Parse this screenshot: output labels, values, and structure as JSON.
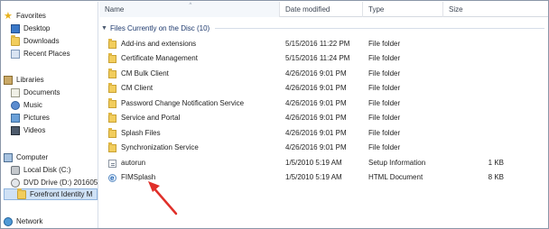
{
  "nav": {
    "favorites": {
      "label": "Favorites",
      "items": [
        {
          "label": "Desktop",
          "icon": "desktop-icon"
        },
        {
          "label": "Downloads",
          "icon": "downloads-icon"
        },
        {
          "label": "Recent Places",
          "icon": "recent-places-icon"
        }
      ]
    },
    "libraries": {
      "label": "Libraries",
      "items": [
        {
          "label": "Documents",
          "icon": "documents-icon"
        },
        {
          "label": "Music",
          "icon": "music-icon"
        },
        {
          "label": "Pictures",
          "icon": "pictures-icon"
        },
        {
          "label": "Videos",
          "icon": "videos-icon"
        }
      ]
    },
    "computer": {
      "label": "Computer",
      "items": [
        {
          "label": "Local Disk (C:)",
          "icon": "local-disk-icon"
        },
        {
          "label": "DVD Drive (D:) 201605",
          "icon": "dvd-drive-icon"
        },
        {
          "label": "Forefront Identity M",
          "icon": "folder-icon",
          "selected": true
        }
      ]
    },
    "network": {
      "label": "Network"
    }
  },
  "columns": {
    "name": "Name",
    "date": "Date modified",
    "type": "Type",
    "size": "Size"
  },
  "group": {
    "label": "Files Currently on the Disc (10)"
  },
  "files": [
    {
      "name": "Add-ins and extensions",
      "date": "5/15/2016 11:22 PM",
      "type": "File folder",
      "size": "",
      "icon": "folder-icon"
    },
    {
      "name": "Certificate Management",
      "date": "5/15/2016 11:24 PM",
      "type": "File folder",
      "size": "",
      "icon": "folder-icon"
    },
    {
      "name": "CM Bulk Client",
      "date": "4/26/2016 9:01 PM",
      "type": "File folder",
      "size": "",
      "icon": "folder-icon"
    },
    {
      "name": "CM Client",
      "date": "4/26/2016 9:01 PM",
      "type": "File folder",
      "size": "",
      "icon": "folder-icon"
    },
    {
      "name": "Password Change Notification Service",
      "date": "4/26/2016 9:01 PM",
      "type": "File folder",
      "size": "",
      "icon": "folder-icon"
    },
    {
      "name": "Service and Portal",
      "date": "4/26/2016 9:01 PM",
      "type": "File folder",
      "size": "",
      "icon": "folder-icon"
    },
    {
      "name": "Splash Files",
      "date": "4/26/2016 9:01 PM",
      "type": "File folder",
      "size": "",
      "icon": "folder-icon"
    },
    {
      "name": "Synchronization Service",
      "date": "4/26/2016 9:01 PM",
      "type": "File folder",
      "size": "",
      "icon": "folder-icon"
    },
    {
      "name": "autorun",
      "date": "1/5/2010 5:19 AM",
      "type": "Setup Information",
      "size": "1 KB",
      "icon": "setup-info-icon"
    },
    {
      "name": "FIMSplash",
      "date": "1/5/2010 5:19 AM",
      "type": "HTML Document",
      "size": "8 KB",
      "icon": "html-document-icon"
    }
  ],
  "colors": {
    "annotation_arrow": "#e0302a",
    "selection": "#cfe1f5",
    "group_text": "#1e3a6e"
  }
}
